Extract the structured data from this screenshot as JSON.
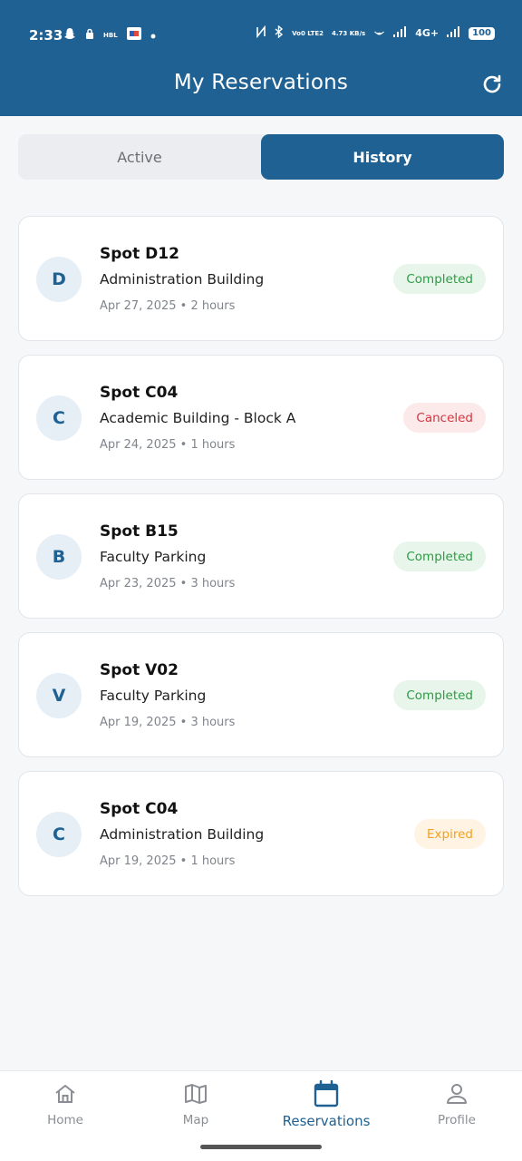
{
  "status_bar": {
    "time": "2:33",
    "carrier_tag": "HBL",
    "volte": "Vo0 LTE2",
    "speed": "4.73 KB/s",
    "network": "4G+",
    "battery": "100"
  },
  "header": {
    "title": "My Reservations",
    "refresh_icon": "refresh-icon"
  },
  "tabs": [
    {
      "label": "Active",
      "selected": false
    },
    {
      "label": "History",
      "selected": true
    }
  ],
  "reservations": [
    {
      "initial": "D",
      "spot": "Spot D12",
      "building": "Administration Building",
      "meta": "Apr 27, 2025 • 2 hours",
      "status": "Completed",
      "status_color": "#2e9b45",
      "status_bg": "#e8f5ea"
    },
    {
      "initial": "C",
      "spot": "Spot C04",
      "building": "Academic Building - Block A",
      "meta": "Apr 24, 2025 • 1 hours",
      "status": "Canceled",
      "status_color": "#d2363f",
      "status_bg": "#fce9ea"
    },
    {
      "initial": "B",
      "spot": "Spot B15",
      "building": "Faculty Parking",
      "meta": "Apr 23, 2025 • 3 hours",
      "status": "Completed",
      "status_color": "#2e9b45",
      "status_bg": "#e8f5ea"
    },
    {
      "initial": "V",
      "spot": "Spot V02",
      "building": "Faculty Parking",
      "meta": "Apr 19, 2025 • 3 hours",
      "status": "Completed",
      "status_color": "#2e9b45",
      "status_bg": "#e8f5ea"
    },
    {
      "initial": "C",
      "spot": "Spot C04",
      "building": "Administration Building",
      "meta": "Apr 19, 2025 • 1 hours",
      "status": "Expired",
      "status_color": "#f2a023",
      "status_bg": "#fff4e3"
    }
  ],
  "bottom_nav": [
    {
      "label": "Home",
      "icon": "home-icon",
      "active": false
    },
    {
      "label": "Map",
      "icon": "map-icon",
      "active": false
    },
    {
      "label": "Reservations",
      "icon": "calendar-icon",
      "active": true
    },
    {
      "label": "Profile",
      "icon": "profile-icon",
      "active": false
    }
  ],
  "colors": {
    "primary": "#1e6192",
    "background": "#f6f7f9",
    "inactive": "#8a8e94"
  }
}
